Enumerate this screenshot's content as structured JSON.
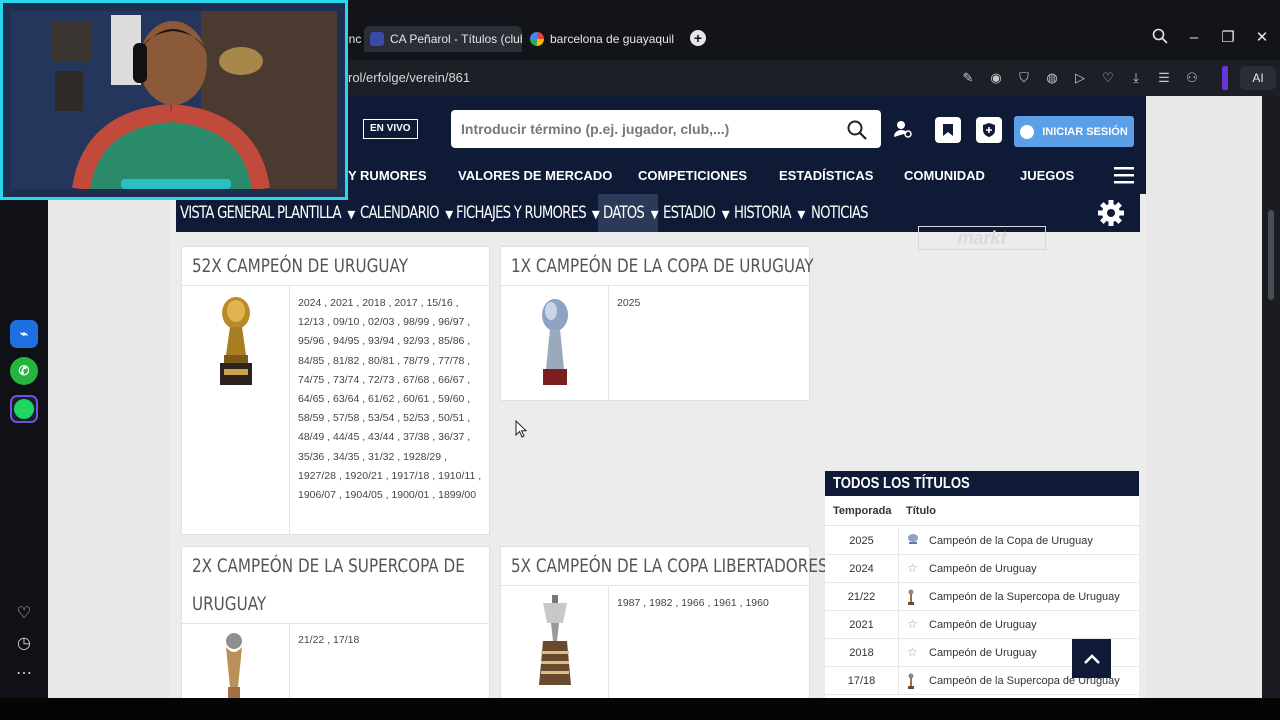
{
  "browser": {
    "tab_partial": "inc",
    "tabs": [
      {
        "label": "CA Peñarol - Títulos (club",
        "active": true
      },
      {
        "label": "barcelona de guayaquil es",
        "active": false
      }
    ],
    "url": "rol/erfolge/verein/861",
    "ai_label": "AI",
    "new_tab": "+"
  },
  "site": {
    "live_label": "EN VIVO",
    "search_placeholder": "Introducir término (p.ej. jugador, club,...)",
    "login_label": "INICIAR SESIÓN",
    "nav_main": [
      "Y RUMORES",
      "VALORES DE MERCADO",
      "COMPETICIONES",
      "ESTADÍSTICAS",
      "COMUNIDAD",
      "JUEGOS"
    ],
    "nav_club": [
      {
        "label": "VISTA GENERAL",
        "dropdown": false
      },
      {
        "label": "PLANTILLA",
        "dropdown": true
      },
      {
        "label": "CALENDARIO",
        "dropdown": true
      },
      {
        "label": "FICHAJES Y RUMORES",
        "dropdown": true
      },
      {
        "label": "DATOS",
        "dropdown": true,
        "selected": true
      },
      {
        "label": "ESTADIO",
        "dropdown": true
      },
      {
        "label": "HISTORIA",
        "dropdown": true
      },
      {
        "label": "NOTICIAS",
        "dropdown": false
      }
    ],
    "caret": "▼"
  },
  "cards": [
    {
      "title": "52X CAMPEÓN DE URUGUAY",
      "years": "2024 , 2021 , 2018 , 2017 , 15/16 , 12/13 , 09/10 , 02/03 , 98/99 , 96/97 , 95/96 , 94/95 , 93/94 , 92/93 , 85/86 , 84/85 , 81/82 , 80/81 , 78/79 , 77/78 , 74/75 , 73/74 , 72/73 , 67/68 , 66/67 , 64/65 , 63/64 , 61/62 , 60/61 , 59/60 , 58/59 , 57/58 , 53/54 , 52/53 , 50/51 , 48/49 , 44/45 , 43/44 , 37/38 , 36/37 , 35/36 , 34/35 , 31/32 , 1928/29 , 1927/28 , 1920/21 , 1917/18 , 1910/11 , 1906/07 , 1904/05 , 1900/01 , 1899/00"
    },
    {
      "title": "1X CAMPEÓN DE LA COPA DE URUGUAY",
      "years": "2025"
    },
    {
      "title_line1": "2X CAMPEÓN DE LA SUPERCOPA DE",
      "title_line2": "URUGUAY",
      "years": "21/22 , 17/18"
    },
    {
      "title": "5X CAMPEÓN DE LA COPA LIBERTADORES",
      "years": "1987 , 1982 , 1966 , 1961 , 1960"
    }
  ],
  "ad": {
    "logo_text": "markt"
  },
  "titles_table": {
    "heading": "TODOS LOS TÍTULOS",
    "col_season": "Temporada",
    "col_title": "Título",
    "rows": [
      {
        "season": "2025",
        "title": "Campeón de la Copa de Uruguay",
        "icon": "copa-icon"
      },
      {
        "season": "2024",
        "title": "Campeón de Uruguay",
        "icon": "star-icon"
      },
      {
        "season": "21/22",
        "title": "Campeón de la Supercopa de Uruguay",
        "icon": "trophy-icon"
      },
      {
        "season": "2021",
        "title": "Campeón de Uruguay",
        "icon": "star-icon"
      },
      {
        "season": "2018",
        "title": "Campeón de Uruguay",
        "icon": "star-icon"
      },
      {
        "season": "17/18",
        "title": "Campeón de la Supercopa de Uruguay",
        "icon": "trophy-icon"
      }
    ]
  },
  "colors": {
    "navy": "#0e1a36",
    "login_blue": "#5b9fe6",
    "webcam_border": "#28d7ec"
  }
}
